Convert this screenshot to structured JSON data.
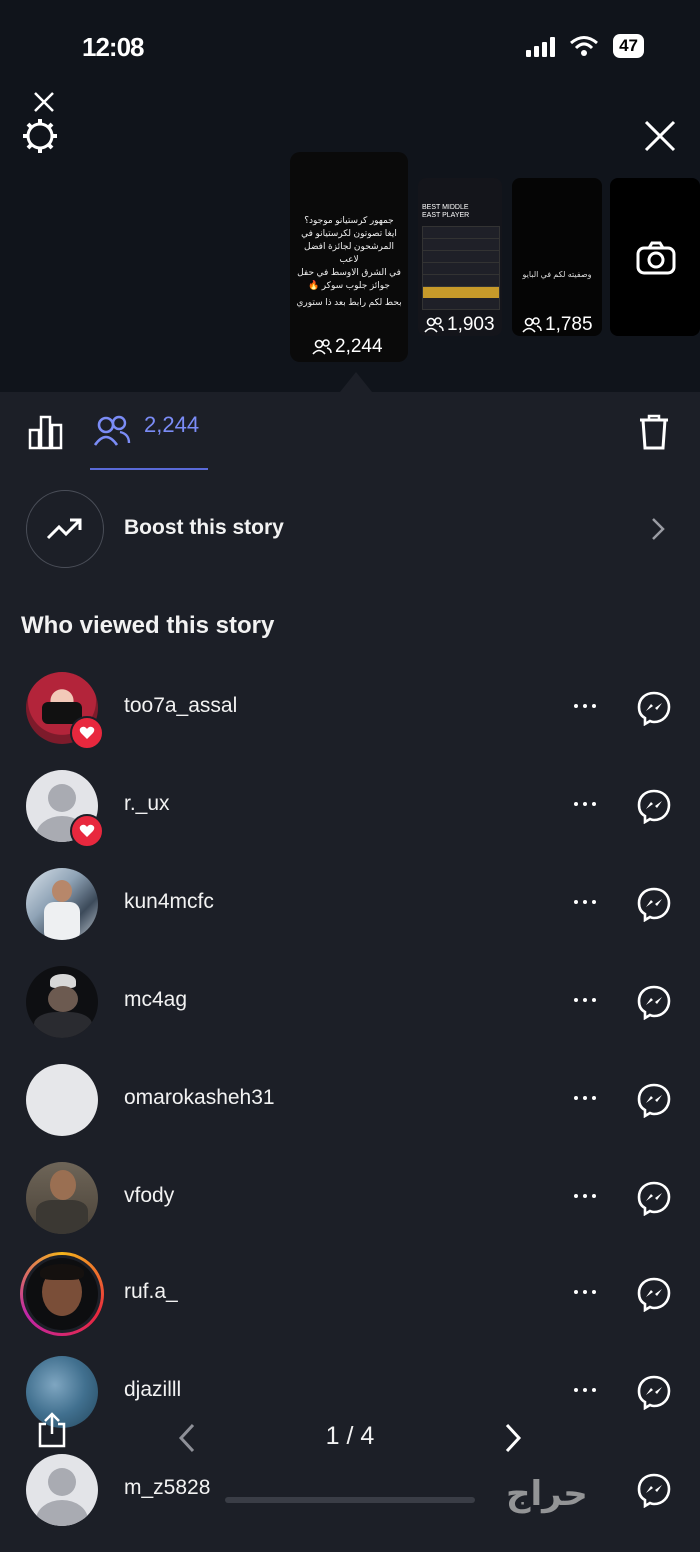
{
  "status_bar": {
    "time": "12:08",
    "battery": "47"
  },
  "stories": [
    {
      "count": "2,244",
      "text_lines": [
        "جمهور كرستيانو موجود؟",
        "ايغا تصوتون لكرستيانو في",
        "المرشحون لجائزة افضل لاعب",
        "في الشرق الاوسط في حفل",
        "جوائز جلوب سوكر 🔥",
        "بحط لكم رابط بعد ذا ستوري"
      ]
    },
    {
      "count": "1,903",
      "title": "BEST MIDDLE EAST PLAYER"
    },
    {
      "count": "1,785",
      "text": "وصفيته لكم في البايو"
    }
  ],
  "tabs": {
    "viewers_count": "2,244"
  },
  "boost": {
    "label": "Boost this story"
  },
  "section_title": "Who viewed this story",
  "viewers": [
    {
      "username": "too7a_assal",
      "liked": true
    },
    {
      "username": "r._ux",
      "liked": true
    },
    {
      "username": "kun4mcfc",
      "liked": false
    },
    {
      "username": "mc4ag",
      "liked": false
    },
    {
      "username": "omarokasheh31",
      "liked": false
    },
    {
      "username": "vfody",
      "liked": false
    },
    {
      "username": "ruf.a_",
      "liked": false
    },
    {
      "username": "djazilll",
      "liked": false
    },
    {
      "username": "m_z5828",
      "liked": false
    }
  ],
  "pager": {
    "label": "1 / 4"
  },
  "watermark": "حراج",
  "colors": {
    "accent": "#7b8cf6",
    "heart": "#e8283e",
    "background": "#1c1f27"
  }
}
